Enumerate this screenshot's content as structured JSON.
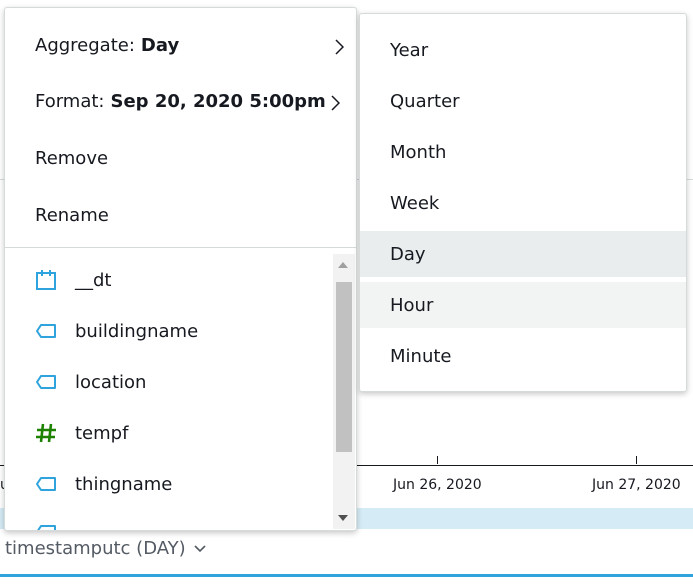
{
  "menu": {
    "aggregate_label": "Aggregate:",
    "aggregate_value": "Day",
    "format_label": "Format:",
    "format_value": "Sep 20, 2020 5:00pm",
    "remove_label": "Remove",
    "rename_label": "Rename"
  },
  "fields": [
    {
      "name": "__dt",
      "icon": "calendar-icon",
      "color": "#2ea3dd"
    },
    {
      "name": "buildingname",
      "icon": "dimension-tag-icon",
      "color": "#2ea3dd"
    },
    {
      "name": "location",
      "icon": "dimension-tag-icon",
      "color": "#2ea3dd"
    },
    {
      "name": "tempf",
      "icon": "hash-measure-icon",
      "color": "#1d8102"
    },
    {
      "name": "thingname",
      "icon": "dimension-tag-icon",
      "color": "#2ea3dd"
    }
  ],
  "aggregate_submenu": {
    "options": [
      "Year",
      "Quarter",
      "Month",
      "Week",
      "Day",
      "Hour",
      "Minute"
    ],
    "selected": "Day",
    "hovered": "Hour"
  },
  "chart": {
    "x_labels": [
      "Jun 26, 2020",
      "Jun 27, 2020"
    ],
    "field_well_label": "timestamputc (DAY)"
  },
  "colors": {
    "accent": "#2ea3dd",
    "measure": "#1d8102",
    "range_fill": "#d5ebf5"
  }
}
